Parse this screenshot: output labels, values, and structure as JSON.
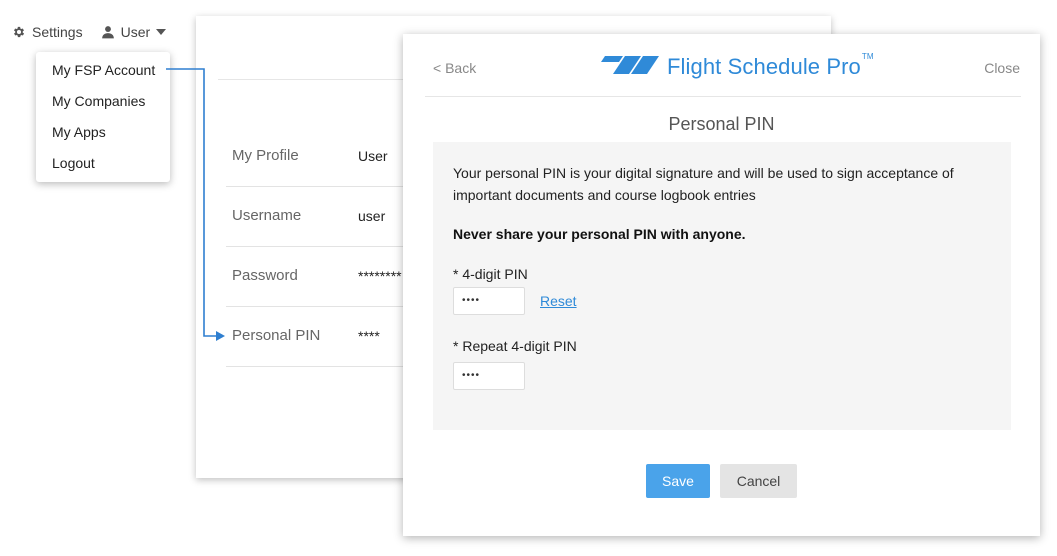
{
  "nav": {
    "settings_label": "Settings",
    "user_label": "User",
    "icons": {
      "settings": "gear-icon",
      "user": "user-icon",
      "caret": "caret-down-icon"
    }
  },
  "dropdown": {
    "items": [
      {
        "label": "My FSP Account"
      },
      {
        "label": "My Companies"
      },
      {
        "label": "My Apps"
      },
      {
        "label": "Logout"
      }
    ]
  },
  "profile": {
    "rows": [
      {
        "label": "My Profile",
        "value": "User"
      },
      {
        "label": "Username",
        "value": "user"
      },
      {
        "label": "Password",
        "value": "********"
      },
      {
        "label": "Personal PIN",
        "value": "****"
      }
    ]
  },
  "modal": {
    "back_label": "< Back",
    "close_label": "Close",
    "logo_text": "Flight Schedule Pro",
    "logo_tm": "TM",
    "title": "Personal PIN",
    "description": "Your personal PIN is your digital signature and will be used to sign acceptance of important documents and course logbook entries",
    "warning": "Never share your personal PIN with anyone.",
    "pin_label": "* 4-digit PIN",
    "pin_value": "••••",
    "reset_label": "Reset",
    "repeat_label": "* Repeat 4-digit PIN",
    "repeat_value": "••••",
    "save_label": "Save",
    "cancel_label": "Cancel"
  },
  "colors": {
    "accent": "#2f8ad8",
    "save_button": "#4aa3ea",
    "cancel_button": "#e4e4e4",
    "content_bg": "#f5f5f5"
  }
}
